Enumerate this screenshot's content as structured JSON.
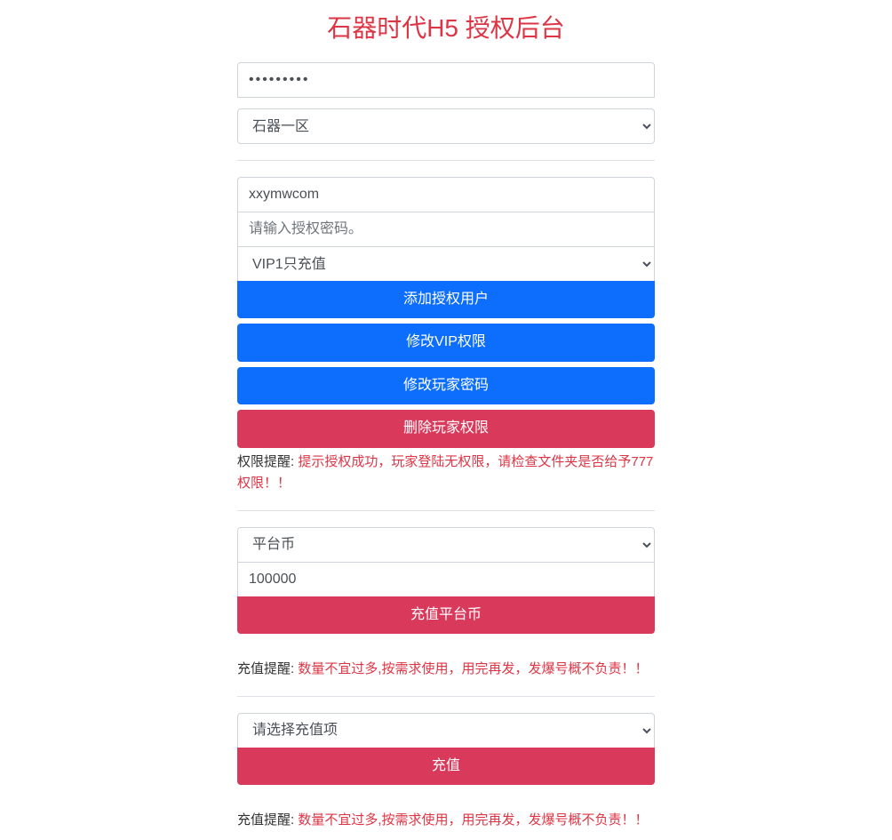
{
  "title": "石器时代H5 授权后台",
  "section1": {
    "password_value": "•••••••••",
    "server_select": "石器一区"
  },
  "section2": {
    "username_value": "xxymwcom",
    "auth_password_placeholder": "请输入授权密码。",
    "vip_select": "VIP1只充值",
    "btn_add_auth_user": "添加授权用户",
    "btn_modify_vip": "修改VIP权限",
    "btn_modify_password": "修改玩家密码",
    "btn_delete_permission": "删除玩家权限",
    "notice_label": "权限提醒: ",
    "notice_msg": "提示授权成功，玩家登陆无权限，请检查文件夹是否给予777权限！！"
  },
  "section3": {
    "currency_select": "平台币",
    "amount_value": "100000",
    "btn_recharge_currency": "充值平台币",
    "notice_label": "充值提醒: ",
    "notice_msg": "数量不宜过多,按需求使用，用完再发，发爆号概不负责！！"
  },
  "section4": {
    "item_select": "请选择充值项",
    "btn_recharge": "充值",
    "notice_label": "充值提醒: ",
    "notice_msg": "数量不宜过多,按需求使用，用完再发，发爆号概不负责！！"
  }
}
